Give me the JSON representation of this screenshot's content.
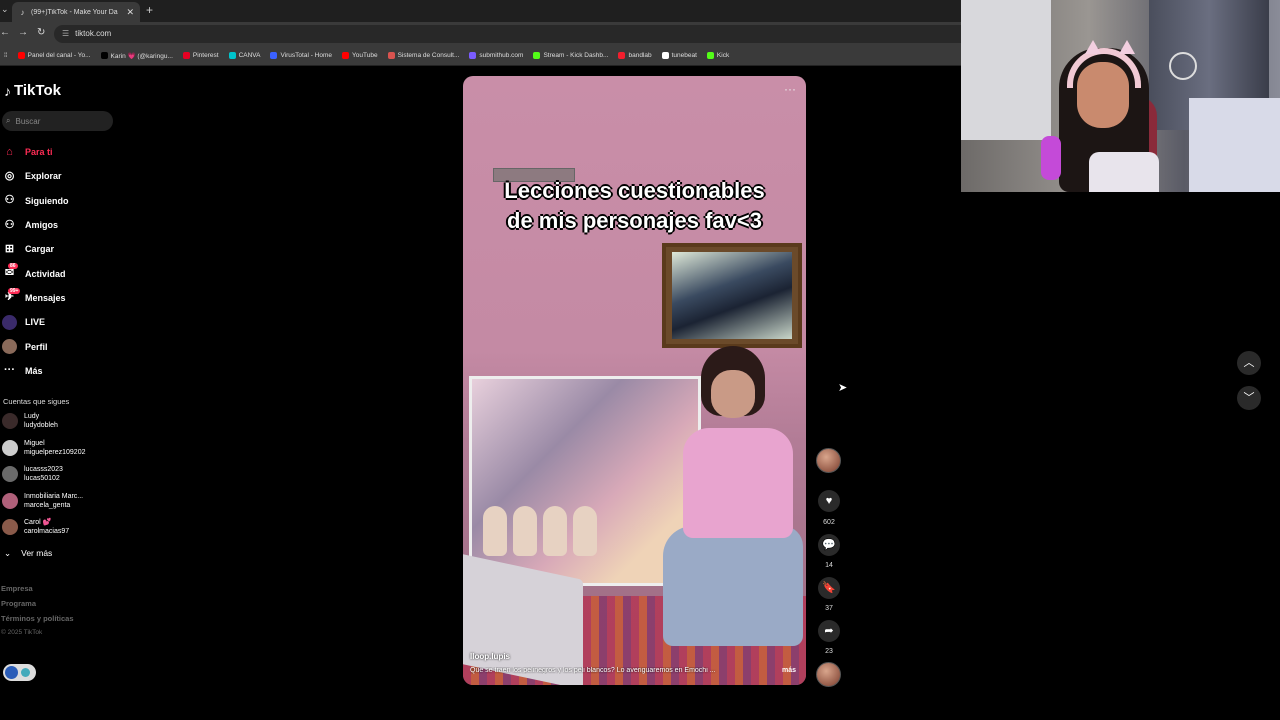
{
  "browser": {
    "tab_title": "(99+)TikTok - Make Your Da",
    "new_tab": "+",
    "url": "tiktok.com",
    "bookmarks": [
      {
        "label": "Panel del canal - Yo...",
        "color": "#ff0000"
      },
      {
        "label": "Karin 💗 (@karingu...",
        "color": "#000000"
      },
      {
        "label": "Pinterest",
        "color": "#e60023"
      },
      {
        "label": "CANVA",
        "color": "#00c4cc"
      },
      {
        "label": "VirusTotal - Home",
        "color": "#3b61ff"
      },
      {
        "label": "YouTube",
        "color": "#ff0000"
      },
      {
        "label": "Sistema de Consult...",
        "color": "#d9534f"
      },
      {
        "label": "submithub.com",
        "color": "#7a5cff"
      },
      {
        "label": "Stream - Kick Dashb...",
        "color": "#53fc18"
      },
      {
        "label": "bandlab",
        "color": "#f21e2d"
      },
      {
        "label": "tunebeat",
        "color": "#ffffff"
      },
      {
        "label": "Kick",
        "color": "#53fc18"
      }
    ]
  },
  "sidebar": {
    "logo": "TikTok",
    "search_placeholder": "Buscar",
    "nav": [
      {
        "label": "Para ti",
        "icon": "home-icon",
        "active": true
      },
      {
        "label": "Explorar",
        "icon": "compass-icon"
      },
      {
        "label": "Siguiendo",
        "icon": "following-icon"
      },
      {
        "label": "Amigos",
        "icon": "friends-icon"
      },
      {
        "label": "Cargar",
        "icon": "upload-icon"
      },
      {
        "label": "Actividad",
        "icon": "activity-icon",
        "badge": "86"
      },
      {
        "label": "Mensajes",
        "icon": "messages-icon",
        "badge": "99+"
      },
      {
        "label": "LIVE",
        "icon": "live-icon"
      },
      {
        "label": "Perfil",
        "icon": "profile-avatar"
      },
      {
        "label": "Más",
        "icon": "more-icon"
      }
    ],
    "following_title": "Cuentas que sigues",
    "accounts": [
      {
        "name": "Ludy",
        "handle": "ludydobleh"
      },
      {
        "name": "Miguel",
        "handle": "miguelperez109202"
      },
      {
        "name": "lucasss2023",
        "handle": "lucas50102"
      },
      {
        "name": "Inmobiliaria Marc...",
        "handle": "marcela_genta"
      },
      {
        "name": "Carol 💕",
        "handle": "carolmacias97"
      }
    ],
    "see_more": "Ver más",
    "footer": [
      "Empresa",
      "Programa",
      "Términos y políticas"
    ],
    "copyright": "© 2025 TikTok"
  },
  "video": {
    "caption_line1": "Lecciones cuestionables",
    "caption_line2": "de mis personajes fav<3",
    "username": "lloop.lupis",
    "description": "Que se traen los pelinegros y los peli blancos? Lo averiguaremos en Emochi ...",
    "more": "más",
    "options": "···"
  },
  "actions": {
    "likes": "602",
    "comments": "14",
    "saves": "37",
    "shares": "23"
  }
}
